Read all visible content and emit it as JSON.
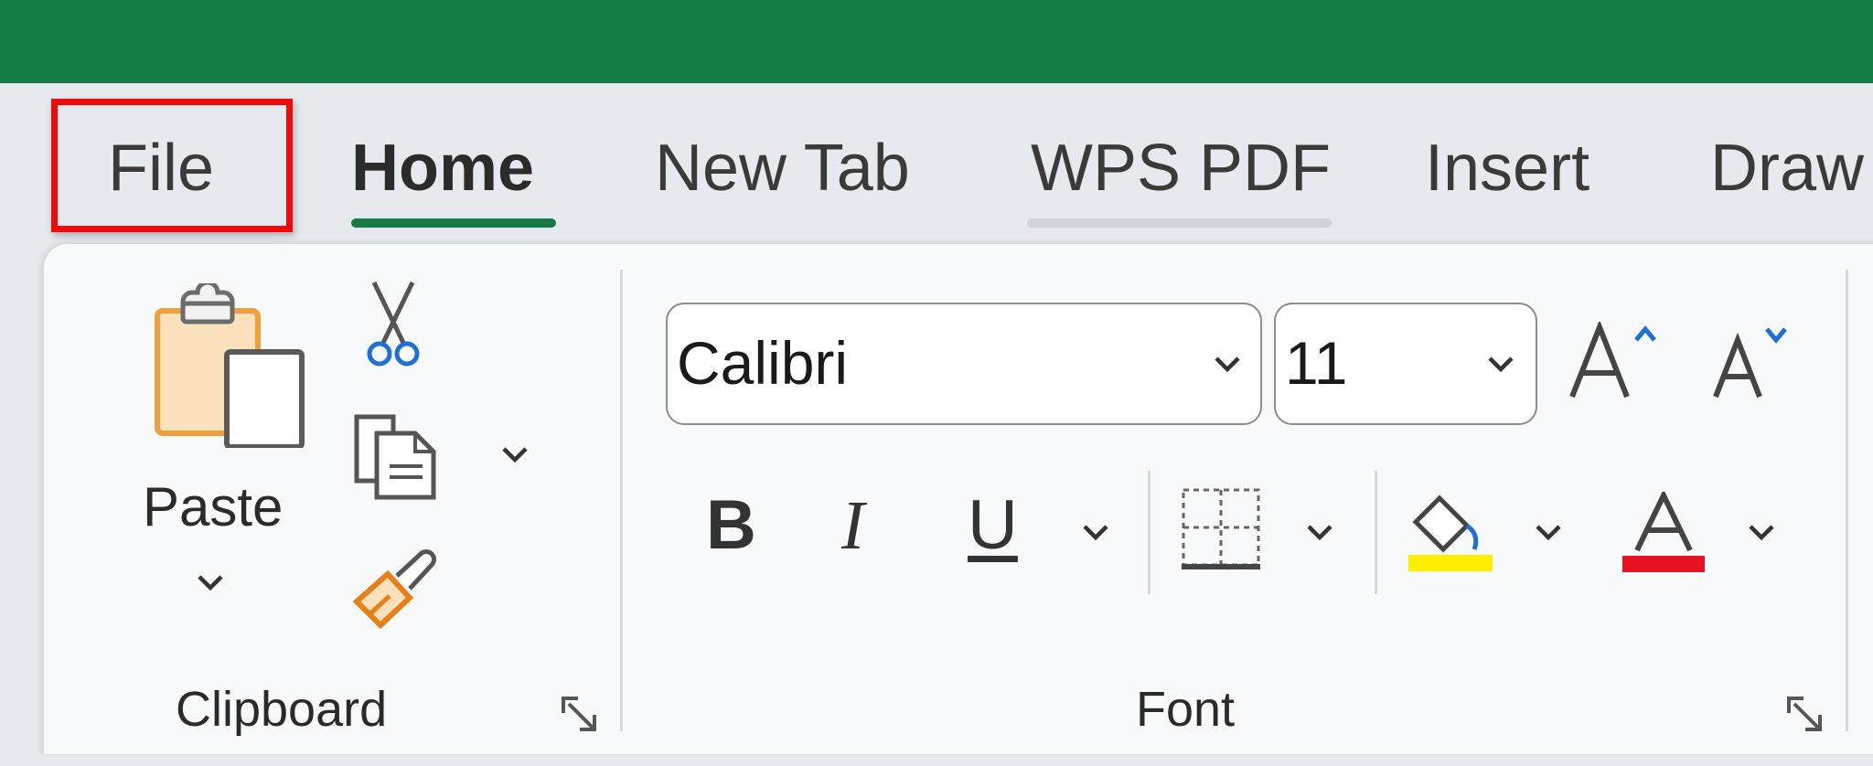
{
  "tabs": [
    {
      "label": "File"
    },
    {
      "label": "Home"
    },
    {
      "label": "New Tab"
    },
    {
      "label": "WPS PDF"
    },
    {
      "label": "Insert"
    },
    {
      "label": "Draw"
    }
  ],
  "clipboard": {
    "paste_label": "Paste",
    "group_label": "Clipboard"
  },
  "font": {
    "font_name": "Calibri",
    "font_size": "11",
    "bold_glyph": "B",
    "italic_glyph": "I",
    "underline_glyph": "U",
    "group_label": "Font"
  },
  "colors": {
    "title_bar": "#137a43",
    "home_underline": "#137a43",
    "highlight_outline": "#ef0b0b",
    "fill_color": "#ffee00",
    "font_color": "#e81123"
  },
  "icons": [
    "paste-icon",
    "cut-icon",
    "copy-icon",
    "format-painter-icon",
    "increase-font-icon",
    "decrease-font-icon",
    "borders-icon",
    "fill-color-icon",
    "font-color-icon",
    "dialog-launcher-icon"
  ]
}
